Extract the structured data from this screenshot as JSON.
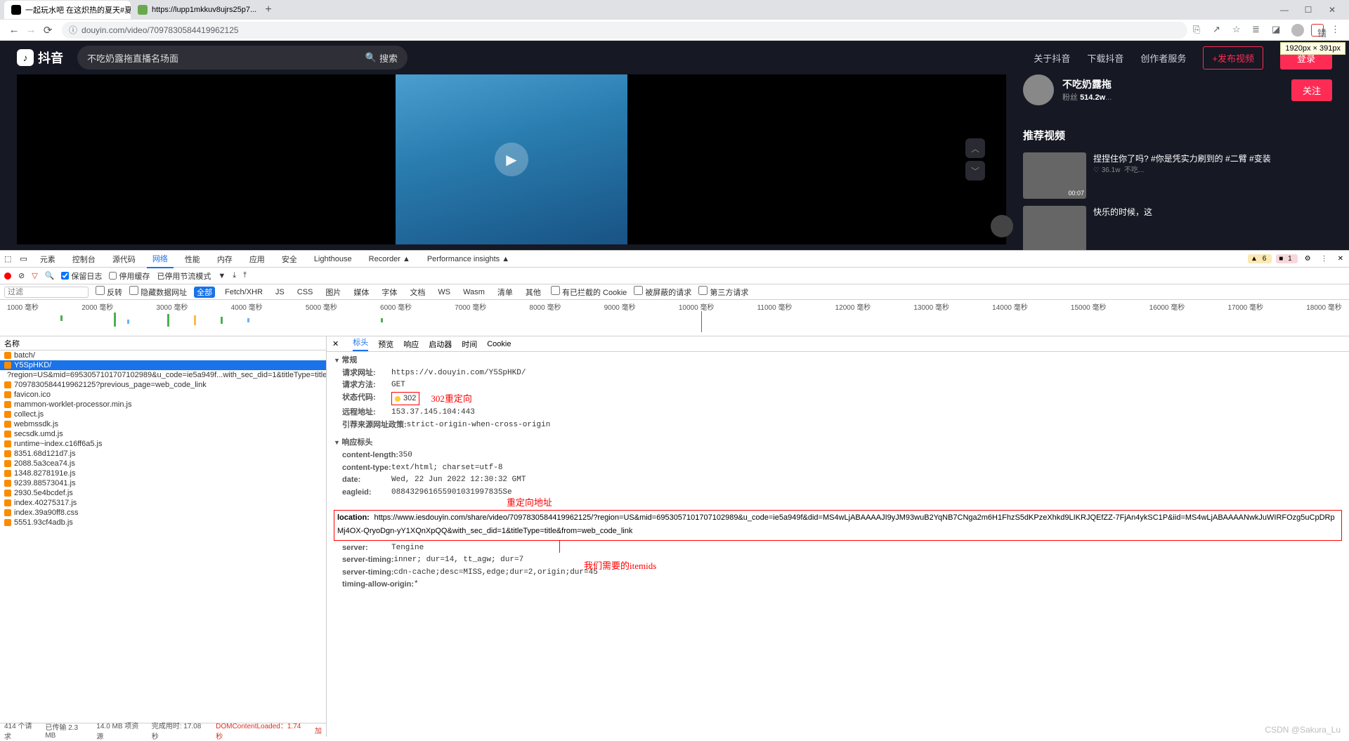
{
  "browser": {
    "tabs": [
      {
        "title": "一起玩水吧 在这炽热的夏天#夏日",
        "favicon": "#000"
      },
      {
        "title": "https://lupp1mkkuv8ujrs25p7...",
        "favicon": "#6aa84f"
      }
    ],
    "url": "douyin.com/video/7097830584419962125",
    "error_btn": "错误"
  },
  "dim_badge": "1920px × 391px",
  "douyin": {
    "brand": "抖音",
    "search_text": "不吃奶露拖直播名场面",
    "search_btn": "搜索",
    "nav": {
      "about": "关于抖音",
      "download": "下载抖音",
      "creator": "创作者服务",
      "publish": "+发布视频",
      "login": "登录"
    },
    "creator_name": "不吃奶露拖",
    "creator_fans_label": "粉丝",
    "creator_fans": "514.2w",
    "follow": "关注",
    "rec_title": "推荐视频",
    "recs": [
      {
        "title": "捏捏住你了吗? #你是凭实力刷到的 #二臂 #变装",
        "duration": "00:07",
        "likes": "36.1w",
        "author": "不吃..."
      },
      {
        "title": "快乐的时候，这"
      }
    ]
  },
  "devtools": {
    "tabs": {
      "elements": "元素",
      "console": "控制台",
      "sources": "源代码",
      "network": "网络",
      "performance": "性能",
      "memory": "内存",
      "application": "应用",
      "security": "安全",
      "lighthouse": "Lighthouse",
      "recorder": "Recorder",
      "perfinsights": "Performance insights"
    },
    "warn_count": "6",
    "err_count": "1",
    "toolbar": {
      "preserve": "保留日志",
      "disable_cache": "停用缓存",
      "throttle": "已停用节流模式"
    },
    "filters": {
      "filter_ph": "过滤",
      "invert": "反转",
      "hide_data": "隐藏数据网址",
      "all": "全部",
      "tabs": [
        "Fetch/XHR",
        "JS",
        "CSS",
        "图片",
        "媒体",
        "字体",
        "文档",
        "WS",
        "Wasm",
        "清单",
        "其他"
      ],
      "blocked_cookie": "有已拦截的 Cookie",
      "blocked_req": "被屏蔽的请求",
      "third_party": "第三方请求"
    },
    "timeline_ticks": [
      "1000 毫秒",
      "2000 毫秒",
      "3000 毫秒",
      "4000 毫秒",
      "5000 毫秒",
      "6000 毫秒",
      "7000 毫秒",
      "8000 毫秒",
      "9000 毫秒",
      "10000 毫秒",
      "11000 毫秒",
      "12000 毫秒",
      "13000 毫秒",
      "14000 毫秒",
      "15000 毫秒",
      "16000 毫秒",
      "17000 毫秒",
      "18000 毫秒"
    ],
    "req_header": "名称",
    "requests": [
      "batch/",
      "Y5SpHKD/",
      "?region=US&mid=6953057101707102989&u_code=ie5a949f...with_sec_did=1&titleType=title&from=wet",
      "7097830584419962125?previous_page=web_code_link",
      "favicon.ico",
      "mammon-worklet-processor.min.js",
      "collect.js",
      "webmssdk.js",
      "secsdk.umd.js",
      "runtime~index.c16ff6a5.js",
      "8351.68d121d7.js",
      "2088.5a3cea74.js",
      "1348.8278191e.js",
      "9239.88573041.js",
      "2930.5e4bcdef.js",
      "index.40275317.js",
      "index.39a90ff8.css",
      "5551.93cf4adb.js"
    ],
    "selected_req_index": 1,
    "footer": {
      "count": "414 个请求",
      "transferred": "已传输 2.3 MB",
      "resources": "14.0 MB 项资源",
      "finish": "完成用时: 17.08 秒",
      "dcl": "DOMContentLoaded：1.74 秒",
      "load": "加"
    },
    "detail_tabs": {
      "headers": "标头",
      "preview": "预览",
      "response": "响应",
      "initiator": "启动器",
      "timing": "时间",
      "cookies": "Cookie"
    },
    "general_h": "常规",
    "general": {
      "url_k": "请求网址:",
      "url_v": "https://v.douyin.com/Y5SpHKD/",
      "method_k": "请求方法:",
      "method_v": "GET",
      "status_k": "状态代码:",
      "status_v": "302",
      "remote_k": "远程地址:",
      "remote_v": "153.37.145.104:443",
      "policy_k": "引荐来源网址政策:",
      "policy_v": "strict-origin-when-cross-origin"
    },
    "annot_302": "302重定向",
    "resp_h": "响应标头",
    "resp_headers": [
      {
        "k": "content-length:",
        "v": "350"
      },
      {
        "k": "content-type:",
        "v": "text/html; charset=utf-8"
      },
      {
        "k": "date:",
        "v": "Wed, 22 Jun 2022 12:30:32 GMT"
      },
      {
        "k": "eagleid:",
        "v": "088432961655901031997835Se"
      }
    ],
    "annot_redirect_addr": "重定向地址",
    "location_k": "location:",
    "location_v": "https://www.iesdouyin.com/share/video/7097830584419962125/?region=US&mid=6953057101707102989&u_code=ie5a949f&did=MS4wLjABAAAAJI9yJM93wuB2YqNB7CNga2m6H1FhzS5dKPzeXhkd9LIKRJQEfZZ-7FjAn4ykSC1P&iid=MS4wLjABAAAANwkJuWIRFOzg5uCpDRpMj4OX-QryoDgn-yY1XQnXpQQ&with_sec_did=1&titleType=title&from=web_code_link",
    "resp_headers2": [
      {
        "k": "server:",
        "v": "Tengine"
      },
      {
        "k": "server-timing:",
        "v": "inner; dur=14, tt_agw; dur=7"
      },
      {
        "k": "server-timing:",
        "v": "cdn-cache;desc=MISS,edge;dur=2,origin;dur=45"
      },
      {
        "k": "timing-allow-origin:",
        "v": "*"
      }
    ],
    "annot_itemids": "我们需要的itemids"
  },
  "watermark": "CSDN @Sakura_Lu"
}
